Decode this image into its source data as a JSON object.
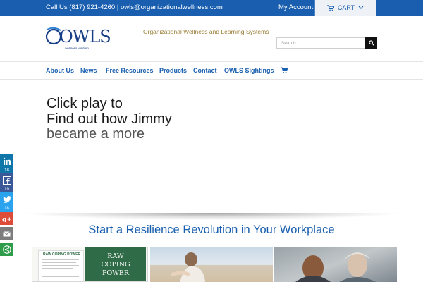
{
  "topbar": {
    "contact_text": "Call Us (817) 921-4260  | owls@organizationalwellness.com",
    "my_account": "My Account",
    "cart_label": "CART"
  },
  "header": {
    "logo_text": "OWLS",
    "logo_subtext": "wellness wisdom",
    "tagline": "Organizational Wellness and Learning Systems",
    "search_placeholder": "Search..."
  },
  "nav": {
    "items": [
      "About Us",
      "News",
      "Free Resources",
      "Products",
      "Contact",
      "OWLS Sightings"
    ]
  },
  "hero": {
    "line1": "Click play to",
    "line2": "Find out how Jimmy",
    "line3": "became a more"
  },
  "social": {
    "linkedin_count": "18",
    "facebook_count": "19",
    "twitter_count": "18"
  },
  "section": {
    "title": "Start a Resilience Revolution in Your Workplace"
  },
  "thumbnails": {
    "doc_heading": "RAW COPING POWER",
    "book_title_1": "RAW",
    "book_title_2": "COPING",
    "book_title_3": "POWER"
  },
  "colors": {
    "brand_blue": "#1a5faf",
    "tagline_gold": "#9a7d35"
  }
}
